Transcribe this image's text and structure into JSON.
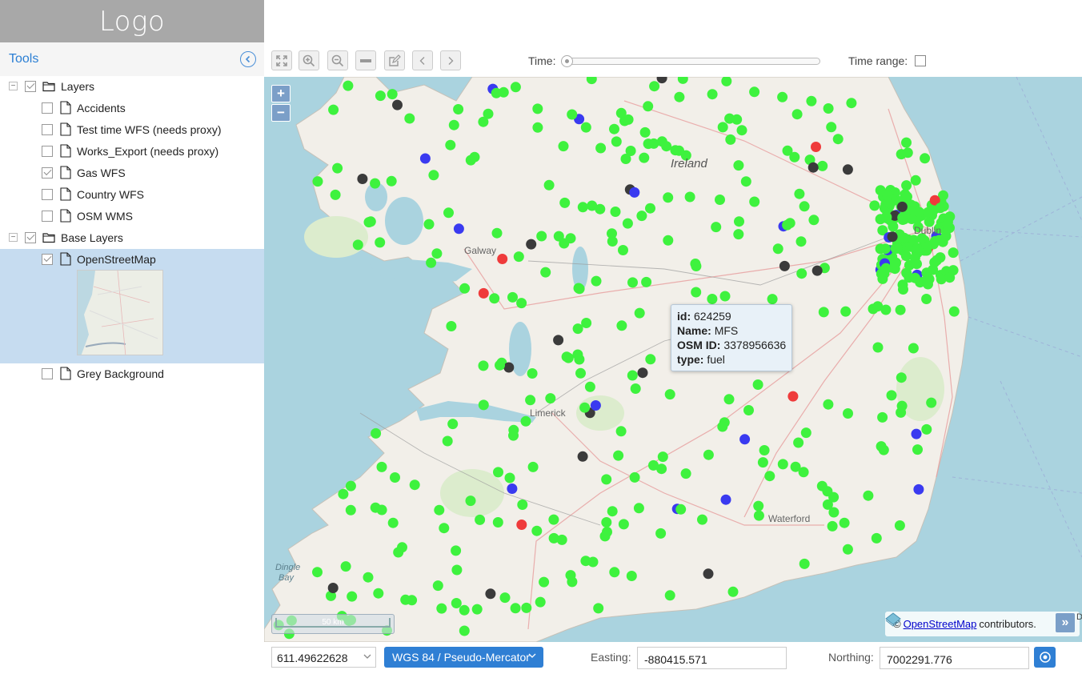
{
  "app": {
    "logo_text": "Logo",
    "tools_title": "Tools"
  },
  "layer_tree": {
    "groups": [
      {
        "label": "Layers",
        "checked": true,
        "expanded": true,
        "items": [
          {
            "label": "Accidents",
            "checked": false
          },
          {
            "label": "Test time WFS (needs proxy)",
            "checked": false
          },
          {
            "label": "Works_Export (needs proxy)",
            "checked": false
          },
          {
            "label": "Gas WFS",
            "checked": true
          },
          {
            "label": "Country WFS",
            "checked": false
          },
          {
            "label": "OSM WMS",
            "checked": false
          }
        ]
      },
      {
        "label": "Base Layers",
        "checked": true,
        "expanded": true,
        "items": [
          {
            "label": "OpenStreetMap",
            "checked": true,
            "selected": true
          },
          {
            "label": "Grey Background",
            "checked": false
          }
        ]
      }
    ]
  },
  "toolbar": {
    "buttons": [
      "zoom-extent",
      "zoom-in",
      "zoom-out",
      "remove",
      "edit",
      "previous",
      "next"
    ],
    "time_label": "Time:",
    "time_range_label": "Time range:",
    "time_range_checked": false,
    "time_slider_value": 0
  },
  "map": {
    "zoom_in_label": "+",
    "zoom_out_label": "−",
    "place_labels": [
      "Ireland",
      "Dublin",
      "Galway",
      "Limerick",
      "Waterford",
      "Dingle Bay"
    ],
    "popup": {
      "fields": [
        {
          "key": "id:",
          "value": "624259"
        },
        {
          "key": "Name:",
          "value": "MFS"
        },
        {
          "key": "OSM ID:",
          "value": "3378956636"
        },
        {
          "key": "type:",
          "value": "fuel"
        }
      ]
    },
    "scale_label": "50 km",
    "attribution": {
      "prefix": "©",
      "link_text": "OpenStreetMap",
      "suffix": "contributors."
    },
    "attribution_button": "»",
    "edge_text": "D",
    "colors": {
      "water": "#aad3df",
      "land": "#f2efe9",
      "fuel_green": "#3ef23e",
      "marker_blue": "#3a3af0",
      "marker_red": "#ef3b3b",
      "marker_dark": "#3b3b3b"
    }
  },
  "footer": {
    "scale_value": "611.49622628",
    "projection": "WGS 84 / Pseudo-Mercator",
    "easting_label": "Easting:",
    "easting_value": "-880415.571",
    "northing_label": "Northing:",
    "northing_value": "7002291.776"
  }
}
